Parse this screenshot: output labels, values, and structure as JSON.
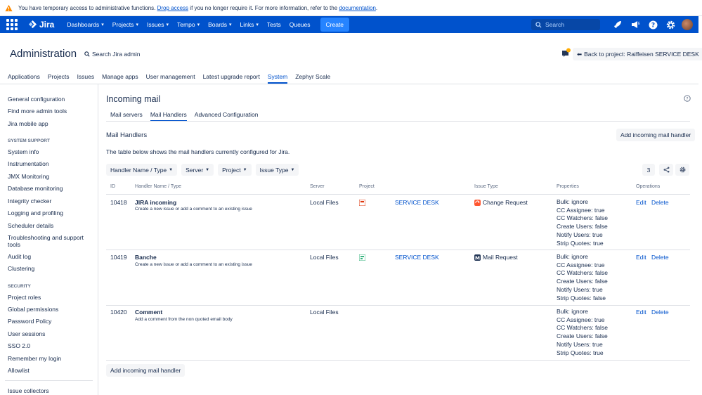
{
  "banner": {
    "text_before": "You have temporary access to administrative functions. ",
    "drop_link": "Drop access",
    "text_middle": " if you no longer require it. For more information, refer to the ",
    "doc_link": "documentation",
    "text_after": "."
  },
  "nav": {
    "product": "Jira",
    "items": [
      "Dashboards",
      "Projects",
      "Issues",
      "Tempo",
      "Boards",
      "Links",
      "Tests",
      "Queues"
    ],
    "create": "Create",
    "search_placeholder": "Search",
    "brand_color": "#0052cc"
  },
  "header": {
    "title": "Administration",
    "search_link": "Search Jira admin",
    "back_button": "Back to project: Raiffeisen SERVICE DESK"
  },
  "admin_tabs": [
    "Applications",
    "Projects",
    "Issues",
    "Manage apps",
    "User management",
    "Latest upgrade report",
    "System",
    "Zephyr Scale"
  ],
  "admin_tab_active": "System",
  "sidebar": {
    "top_items": [
      "General configuration",
      "Find more admin tools",
      "Jira mobile app"
    ],
    "system_support_heading": "SYSTEM SUPPORT",
    "system_support_items": [
      "System info",
      "Instrumentation",
      "JMX Monitoring",
      "Database monitoring",
      "Integrity checker",
      "Logging and profiling",
      "Scheduler details",
      "Troubleshooting and support tools",
      "Audit log",
      "Clustering"
    ],
    "security_heading": "SECURITY",
    "security_items": [
      "Project roles",
      "Global permissions",
      "Password Policy",
      "User sessions",
      "SSO 2.0",
      "Remember my login",
      "Allowlist"
    ],
    "bottom_items": [
      "Issue collectors"
    ]
  },
  "main": {
    "title": "Incoming mail",
    "subtabs": [
      "Mail servers",
      "Mail Handlers",
      "Advanced Configuration"
    ],
    "subtab_active": "Mail Handlers",
    "section_title": "Mail Handlers",
    "add_button": "Add incoming mail handler",
    "description": "The table below shows the mail handlers currently configured for Jira.",
    "filters": [
      "Handler Name / Type",
      "Server",
      "Project",
      "Issue Type"
    ],
    "count": "3"
  },
  "table": {
    "headers": [
      "ID",
      "Handler Name / Type",
      "Server",
      "Project",
      "Issue Type",
      "Properties",
      "Operations"
    ],
    "rows": [
      {
        "id": "10418",
        "name": "JIRA incoming",
        "type_desc": "Create a new issue or add a comment to an existing issue",
        "server": "Local Files",
        "project": "SERVICE DESK",
        "issue_type": "Change Request",
        "props": [
          {
            "k": "Bulk:",
            "v": "ignore"
          },
          {
            "k": "CC Assignee:",
            "v": "true"
          },
          {
            "k": "CC Watchers:",
            "v": "false"
          },
          {
            "k": "Create Users:",
            "v": "false"
          },
          {
            "k": "Notify Users:",
            "v": "true"
          },
          {
            "k": "Strip Quotes:",
            "v": "true"
          }
        ],
        "edit": "Edit",
        "delete": "Delete"
      },
      {
        "id": "10419",
        "name": "Banche",
        "type_desc": "Create a new issue or add a comment to an existing issue",
        "server": "Local Files",
        "project": "SERVICE DESK",
        "issue_type": "Mail Request",
        "props": [
          {
            "k": "Bulk:",
            "v": "ignore"
          },
          {
            "k": "CC Assignee:",
            "v": "true"
          },
          {
            "k": "CC Watchers:",
            "v": "false"
          },
          {
            "k": "Create Users:",
            "v": "false"
          },
          {
            "k": "Notify Users:",
            "v": "true"
          },
          {
            "k": "Strip Quotes:",
            "v": "false"
          }
        ],
        "edit": "Edit",
        "delete": "Delete"
      },
      {
        "id": "10420",
        "name": "Comment",
        "type_desc": "Add a comment from the non quoted email body",
        "server": "Local Files",
        "project": "",
        "issue_type": "",
        "props": [
          {
            "k": "Bulk:",
            "v": "ignore"
          },
          {
            "k": "CC Assignee:",
            "v": "true"
          },
          {
            "k": "CC Watchers:",
            "v": "false"
          },
          {
            "k": "Create Users:",
            "v": "false"
          },
          {
            "k": "Notify Users:",
            "v": "true"
          },
          {
            "k": "Strip Quotes:",
            "v": "true"
          }
        ],
        "edit": "Edit",
        "delete": "Delete"
      }
    ]
  },
  "bottom_add_button": "Add incoming mail handler"
}
